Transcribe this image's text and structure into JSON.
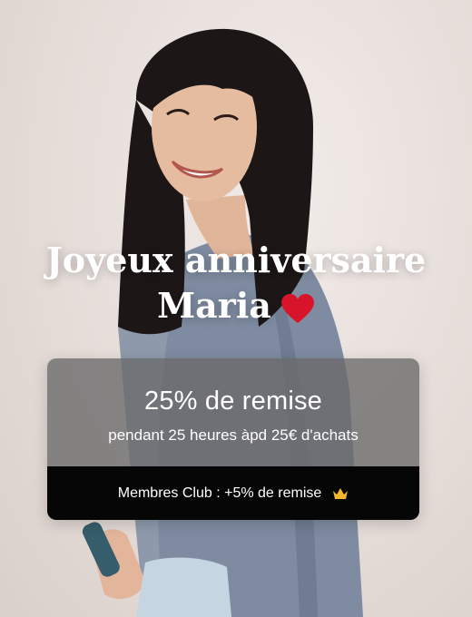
{
  "banner": {
    "greeting_line1": "Joyeux anniversaire",
    "greeting_name": "Maria",
    "heart_icon": "heart-icon",
    "offer_title": "25% de remise",
    "offer_subtitle": "pendant 25 heures àpd 25€ d'achats",
    "club_text": "Membres Club : +5% de remise",
    "crown_icon": "crown-icon"
  },
  "colors": {
    "heart": "#d7142a",
    "crown": "#f3b62f",
    "card_bottom": "#060606",
    "card_top": "#696969"
  }
}
